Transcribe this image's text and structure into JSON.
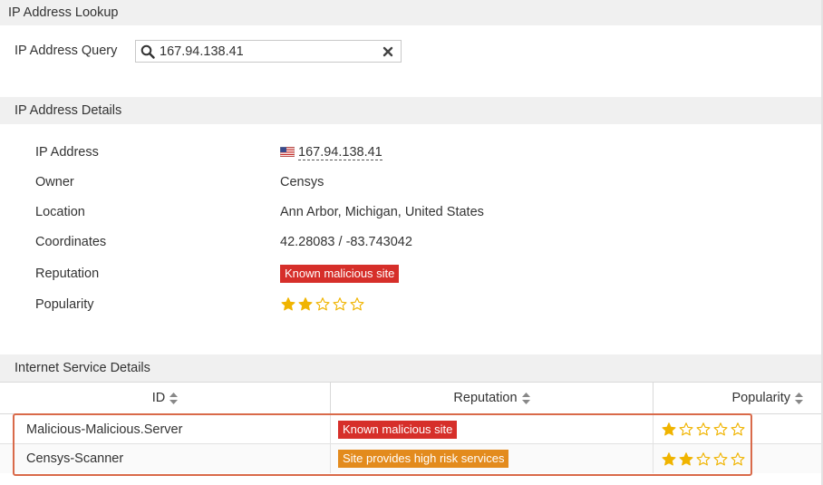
{
  "lookup": {
    "section_title": "IP Address Lookup",
    "query_label": "IP Address Query",
    "query_value": "167.94.138.41"
  },
  "details": {
    "section_title": "IP Address Details",
    "labels": {
      "ip": "IP Address",
      "owner": "Owner",
      "location": "Location",
      "coordinates": "Coordinates",
      "reputation": "Reputation",
      "popularity": "Popularity"
    },
    "ip": "167.94.138.41",
    "flag": "us-flag-icon",
    "owner": "Censys",
    "location": "Ann Arbor, Michigan, United States",
    "coordinates": "42.28083 / -83.743042",
    "reputation": "Known malicious site",
    "popularity_stars": 2,
    "popularity_max": 5
  },
  "service": {
    "section_title": "Internet Service Details",
    "columns": [
      "ID",
      "Reputation",
      "Popularity"
    ],
    "rows": [
      {
        "id": "Malicious-Malicious.Server",
        "reputation": "Known malicious site",
        "reputation_color": "#d62f2a",
        "popularity": 1
      },
      {
        "id": "Censys-Scanner",
        "reputation": "Site provides high risk services",
        "reputation_color": "#e38b1d",
        "popularity": 2
      }
    ]
  },
  "colors": {
    "star": "#f0b400",
    "danger": "#d62f2a",
    "warning": "#e38b1d",
    "highlight": "#d96a4a"
  }
}
